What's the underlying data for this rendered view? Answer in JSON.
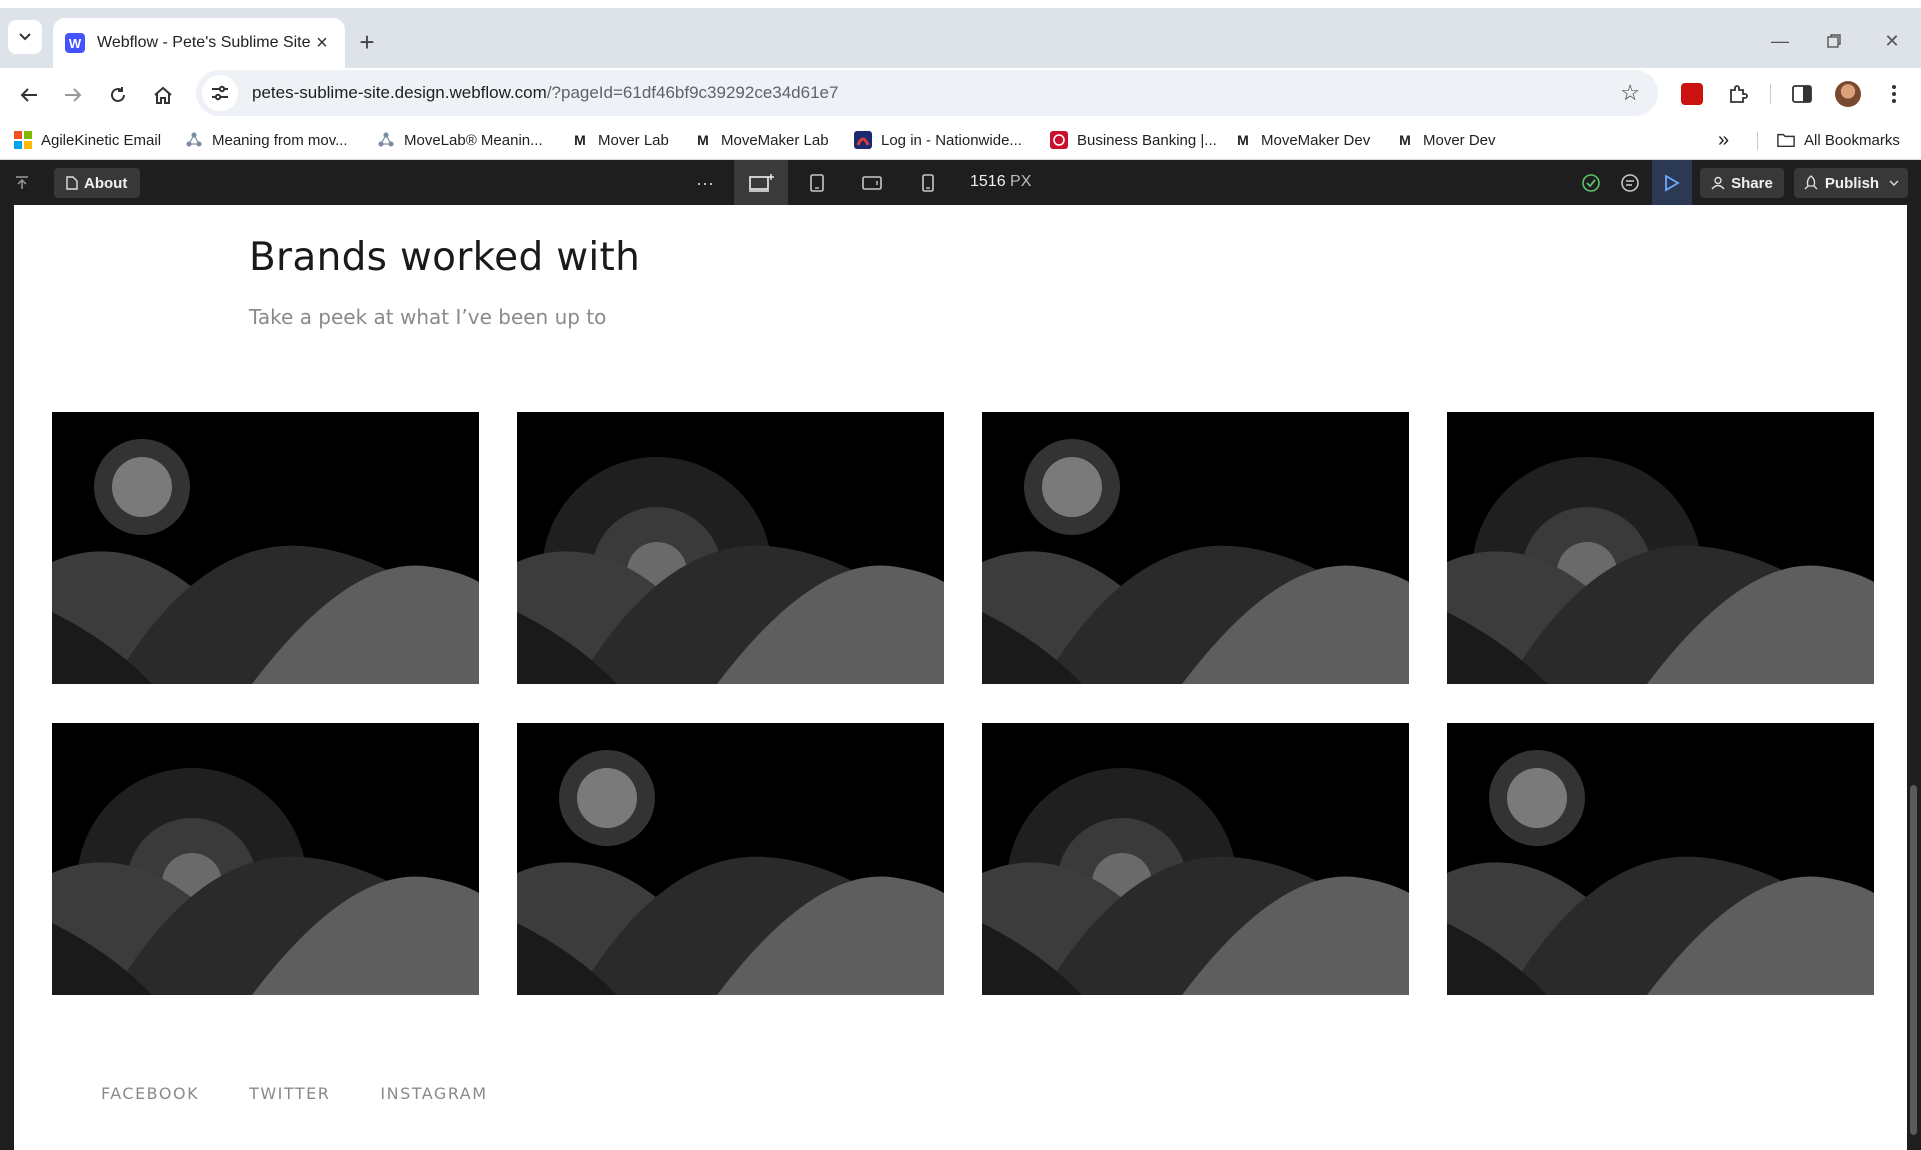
{
  "browser": {
    "tab_title": "Webflow - Pete's Sublime Site",
    "favicon_letter": "W",
    "url_host": "petes-sublime-site.design.webflow.com",
    "url_path": "/?pageId=61df46bf9c39292ce34d61e7",
    "bookmarks": [
      {
        "label": "AgileKinetic Email",
        "icon": "microsoft-icon"
      },
      {
        "label": "Meaning from mov...",
        "icon": "movelab-icon"
      },
      {
        "label": "MoveLab® Meanin...",
        "icon": "movelab-icon"
      },
      {
        "label": "Mover Lab",
        "icon": "m-icon"
      },
      {
        "label": "MoveMaker Lab",
        "icon": "m-icon"
      },
      {
        "label": "Log in - Nationwide...",
        "icon": "nationwide-icon"
      },
      {
        "label": "Business Banking |...",
        "icon": "bank-icon"
      },
      {
        "label": "MoveMaker Dev",
        "icon": "m-icon"
      },
      {
        "label": "Mover Dev",
        "icon": "m-icon"
      }
    ],
    "bookmark_m_glyph": "M",
    "all_bookmarks": "All Bookmarks",
    "overflow_glyph": "»"
  },
  "designer": {
    "page_label": "About",
    "more_glyph": "···",
    "canvas_width_value": "1516",
    "canvas_width_unit": "PX",
    "share_label": "Share",
    "publish_label": "Publish"
  },
  "page": {
    "heading": "Brands worked with",
    "subheading": "Take a peek at what I’ve been up to",
    "images": [
      {
        "style": "small-moon"
      },
      {
        "style": "large-sun"
      },
      {
        "style": "small-moon"
      },
      {
        "style": "large-sun"
      },
      {
        "style": "large-sun"
      },
      {
        "style": "small-moon"
      },
      {
        "style": "large-sun"
      },
      {
        "style": "small-moon"
      }
    ],
    "footer_links": [
      "FACEBOOK",
      "TWITTER",
      "INSTAGRAM"
    ]
  }
}
